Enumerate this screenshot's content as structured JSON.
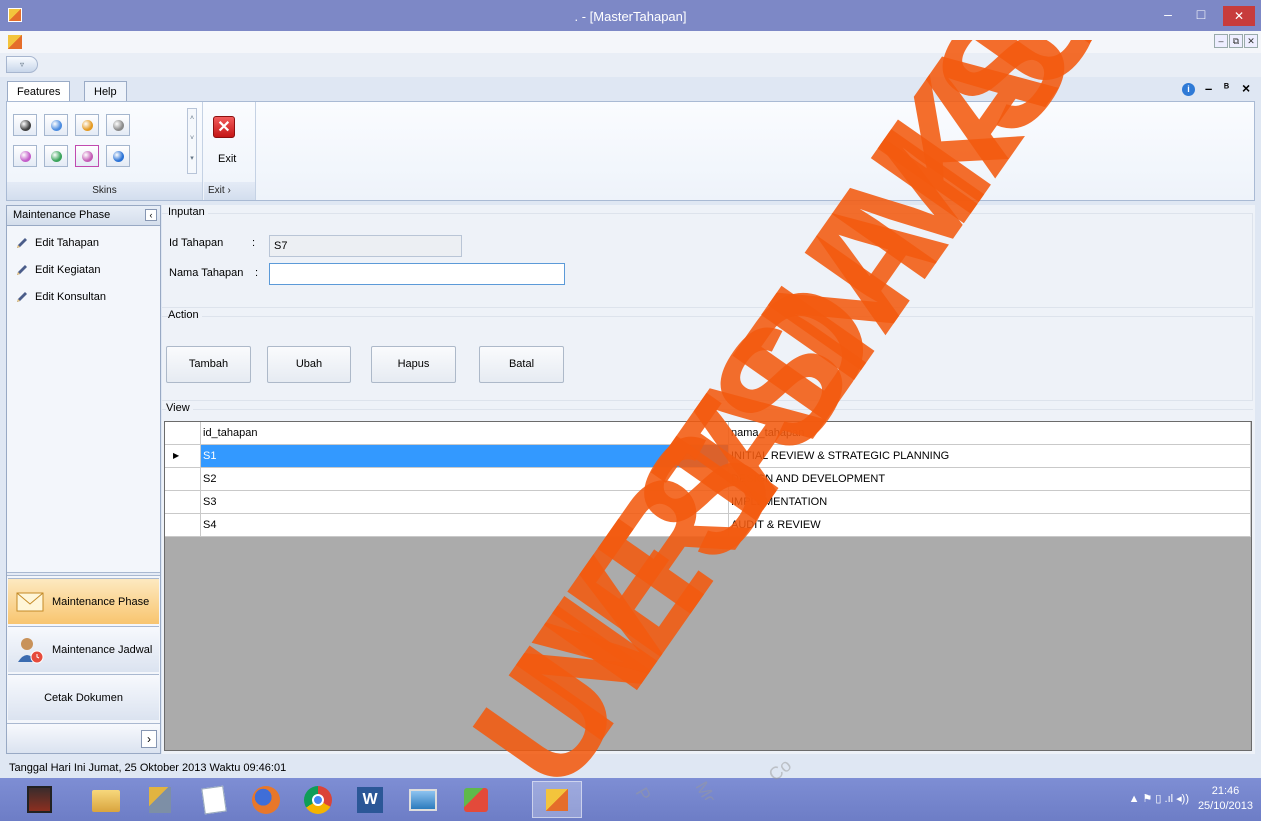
{
  "window": {
    "title": ". - [MasterTahapan]",
    "minimize": "–",
    "maximize": "□",
    "close": "✕"
  },
  "mdi": {
    "minimize": "–",
    "restore": "⧉",
    "close": "✕"
  },
  "ribbon": {
    "tabs": [
      "Features",
      "Help"
    ],
    "skins_label": "Skins",
    "exit_label": "Exit",
    "exit_group_label": "Exit",
    "exit_group_arrow": "›",
    "right_icons": {
      "info": "i",
      "minimize": "–",
      "restore": "ᴮ",
      "close": "×"
    },
    "skin_colors": [
      "#3f3f3f",
      "#4a8be0",
      "#e49a22",
      "#8a8a8a",
      "#c35cc9",
      "#3aa35a",
      "#c45cb5",
      "#2a72d6"
    ]
  },
  "sidebar": {
    "header": "Maintenance Phase",
    "collapse": "‹",
    "items": [
      "Edit Tahapan",
      "Edit Kegiatan",
      "Edit Konsultan"
    ],
    "nav": [
      "Maintenance Phase",
      "Maintenance Jadwal",
      "Cetak Dokumen"
    ],
    "expand": "›"
  },
  "form": {
    "inputan_label": "Inputan",
    "id_label": "Id Tahapan",
    "id_colon": ":",
    "id_value": "S7",
    "nama_label": "Nama Tahapan",
    "nama_colon": ":",
    "nama_value": "",
    "action_label": "Action",
    "buttons": [
      "Tambah",
      "Ubah",
      "Hapus",
      "Batal"
    ],
    "view_label": "View"
  },
  "grid": {
    "columns": [
      "id_tahapan",
      "nama_tahapan"
    ],
    "rows": [
      {
        "id": "S1",
        "nama": "INITIAL REVIEW & STRATEGIC PLANNING",
        "selected": true
      },
      {
        "id": "S2",
        "nama": "DESIGN AND DEVELOPMENT",
        "selected": false
      },
      {
        "id": "S3",
        "nama": "IMPLEMENTATION",
        "selected": false
      },
      {
        "id": "S4",
        "nama": "AUDIT & REVIEW",
        "selected": false
      }
    ],
    "row_indicator": "▶"
  },
  "status": {
    "text": "Tanggal Hari Ini  Jumat, 25 Oktober 2013  Waktu  09:46:01"
  },
  "taskbar": {
    "apps": [
      "game-icon",
      "file-explorer-icon",
      "paint-tools-icon",
      "notepad-icon",
      "firefox-icon",
      "chrome-icon",
      "word-icon",
      "photo-viewer-icon",
      "app-installer-icon",
      "app-window-icon"
    ],
    "tray": "▲  ⚑  ▯  .ıl  ◂))",
    "time": "21:46",
    "date": "25/10/2013"
  },
  "watermark": {
    "text": "UNIVERSITAS DINAMIKA SURABAYA",
    "faint": [
      "Pa",
      "Moni",
      "Co"
    ]
  }
}
